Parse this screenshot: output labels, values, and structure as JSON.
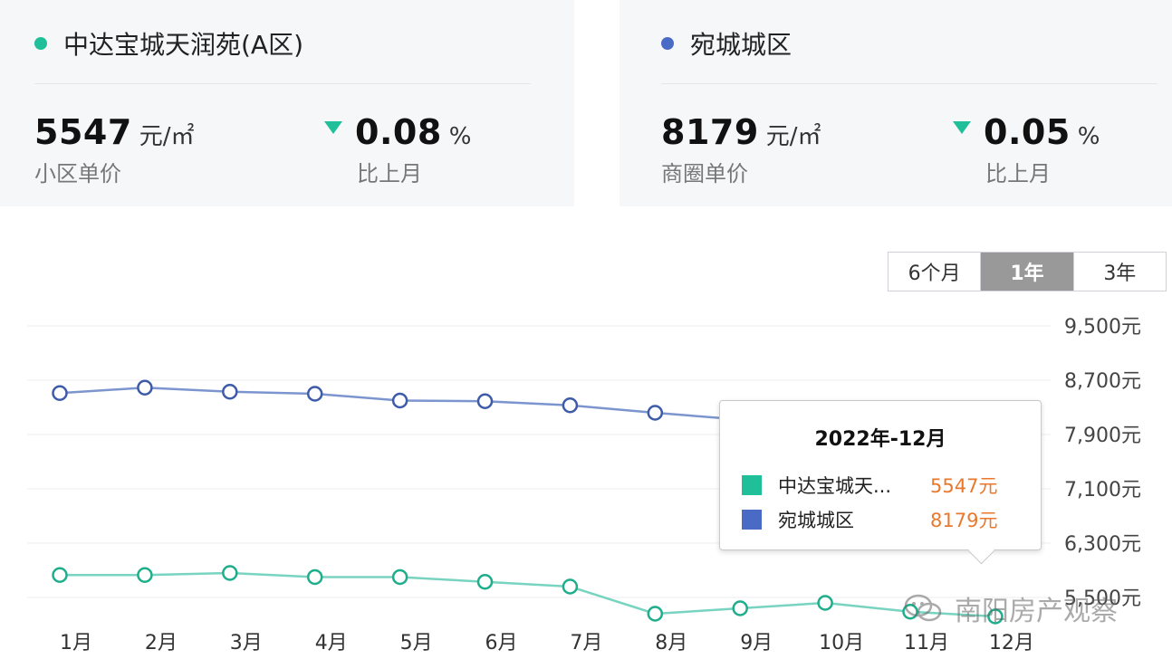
{
  "cards": [
    {
      "title": "中达宝城天润苑(A区)",
      "dot_color": "#1fbf9a",
      "price": "5547",
      "unit": "元/㎡",
      "price_label": "小区单价",
      "change": "0.08",
      "change_unit": "%",
      "change_label": "比上月"
    },
    {
      "title": "宛城城区",
      "dot_color": "#4a6bc5",
      "price": "8179",
      "unit": "元/㎡",
      "price_label": "商圈单价",
      "change": "0.05",
      "change_unit": "%",
      "change_label": "比上月"
    }
  ],
  "tabs": [
    {
      "label": "6个月",
      "active": false
    },
    {
      "label": "1年",
      "active": true
    },
    {
      "label": "3年",
      "active": false
    }
  ],
  "chart_data": {
    "type": "line",
    "categories": [
      "1月",
      "2月",
      "3月",
      "4月",
      "5月",
      "6月",
      "7月",
      "8月",
      "9月",
      "10月",
      "11月",
      "12月"
    ],
    "y_ticks": [
      "9,500元",
      "8,700元",
      "7,900元",
      "7,100元",
      "6,300元",
      "5,500元"
    ],
    "ylim": [
      5500,
      9500
    ],
    "grid": true,
    "series": [
      {
        "name": "宛城城区",
        "color": "#7c95cf",
        "marker_color": "#3d5ba8",
        "values": [
          8510,
          8590,
          8530,
          8500,
          8400,
          8390,
          8330,
          8220,
          8120,
          8140,
          8160,
          8179
        ]
      },
      {
        "name": "中达宝城天润苑(A区)",
        "color": "#78d4c0",
        "marker_color": "#1fae8c",
        "values": [
          5830,
          5830,
          5860,
          5800,
          5800,
          5730,
          5660,
          5260,
          5340,
          5420,
          5290,
          5220
        ]
      }
    ]
  },
  "tooltip": {
    "title": "2022年-12月",
    "rows": [
      {
        "name": "中达宝城天...",
        "value": "5547元",
        "color": "#1fbf9a"
      },
      {
        "name": "宛城城区",
        "value": "8179元",
        "color": "#4a6bc5"
      }
    ]
  },
  "watermark": "南阳房产观察"
}
